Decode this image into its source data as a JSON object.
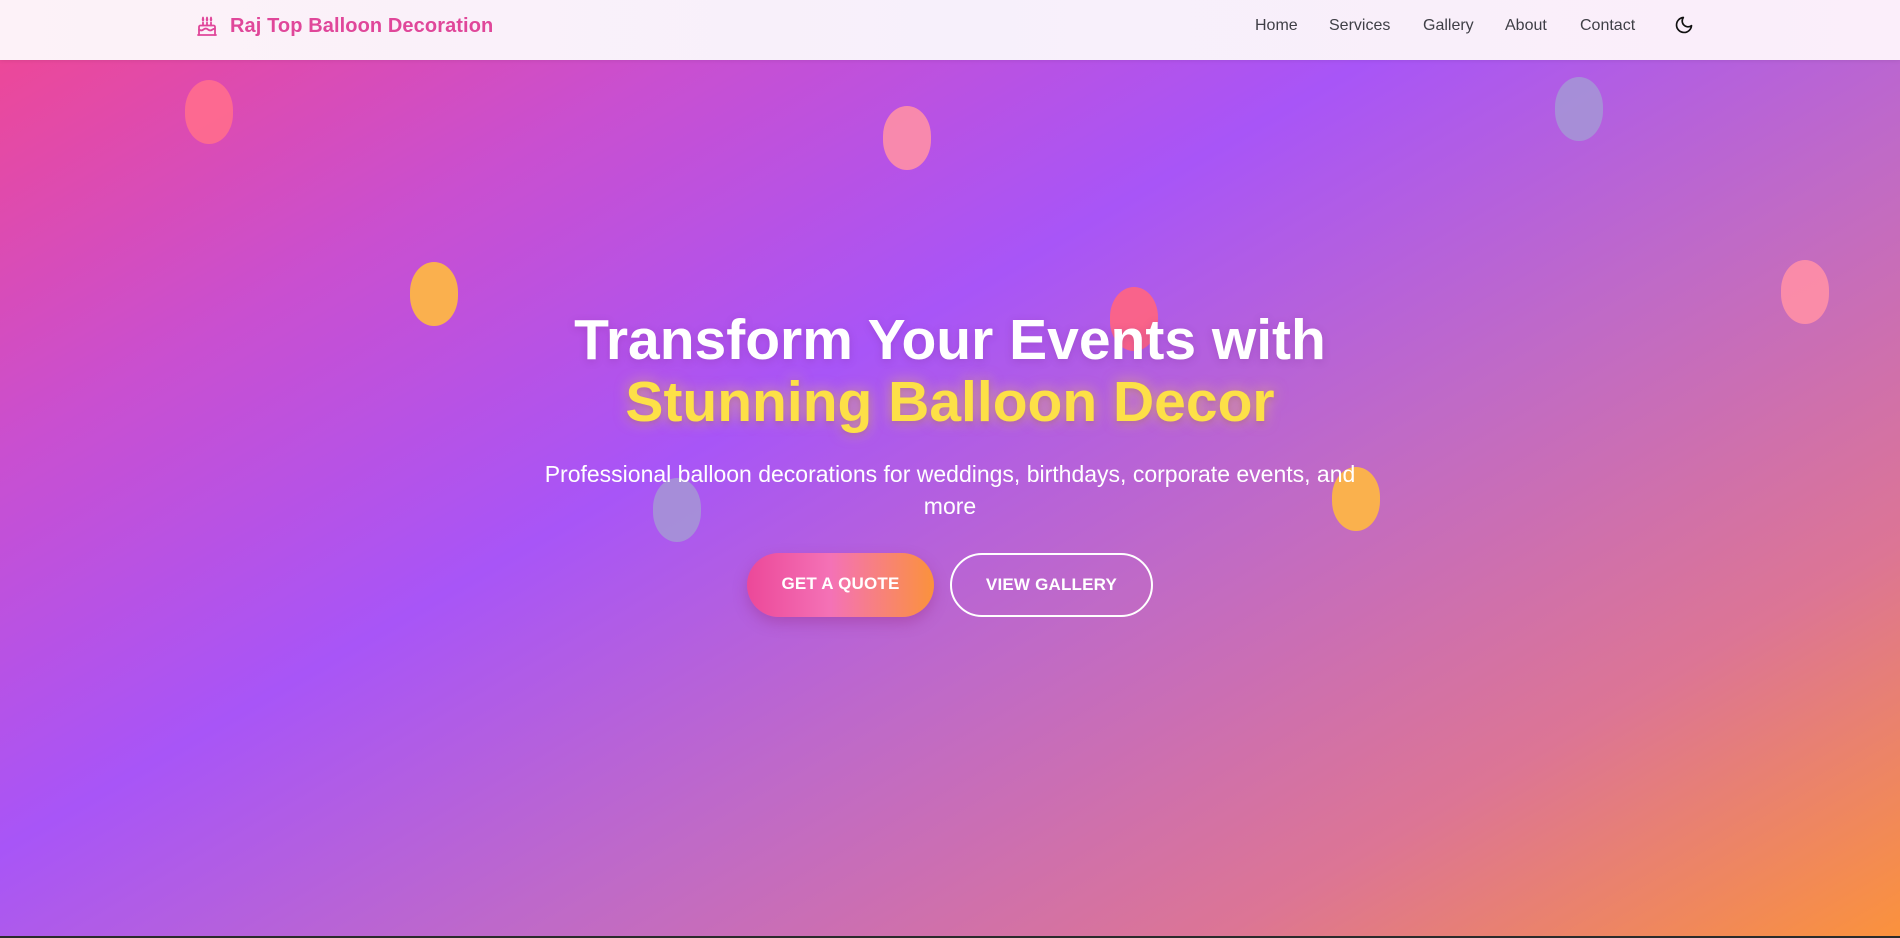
{
  "brand": {
    "name": "Raj Top Balloon Decoration",
    "icon": "cake-icon",
    "color": "#e0479a"
  },
  "nav": {
    "links": [
      {
        "label": "Home"
      },
      {
        "label": "Services"
      },
      {
        "label": "Gallery"
      },
      {
        "label": "About"
      },
      {
        "label": "Contact"
      }
    ],
    "theme_toggle_icon": "moon-icon"
  },
  "hero": {
    "title_line1": "Transform Your Events with",
    "title_line2": "Stunning Balloon Decor",
    "subtitle": "Professional balloon decorations for weddings, birthdays, corporate events, and more",
    "primary_button": "GET A QUOTE",
    "secondary_button": "VIEW GALLERY",
    "colors": {
      "gradient_start": "#ec4899",
      "gradient_mid": "#a855f7",
      "gradient_end": "#fb923c",
      "highlight": "#fde047"
    }
  }
}
